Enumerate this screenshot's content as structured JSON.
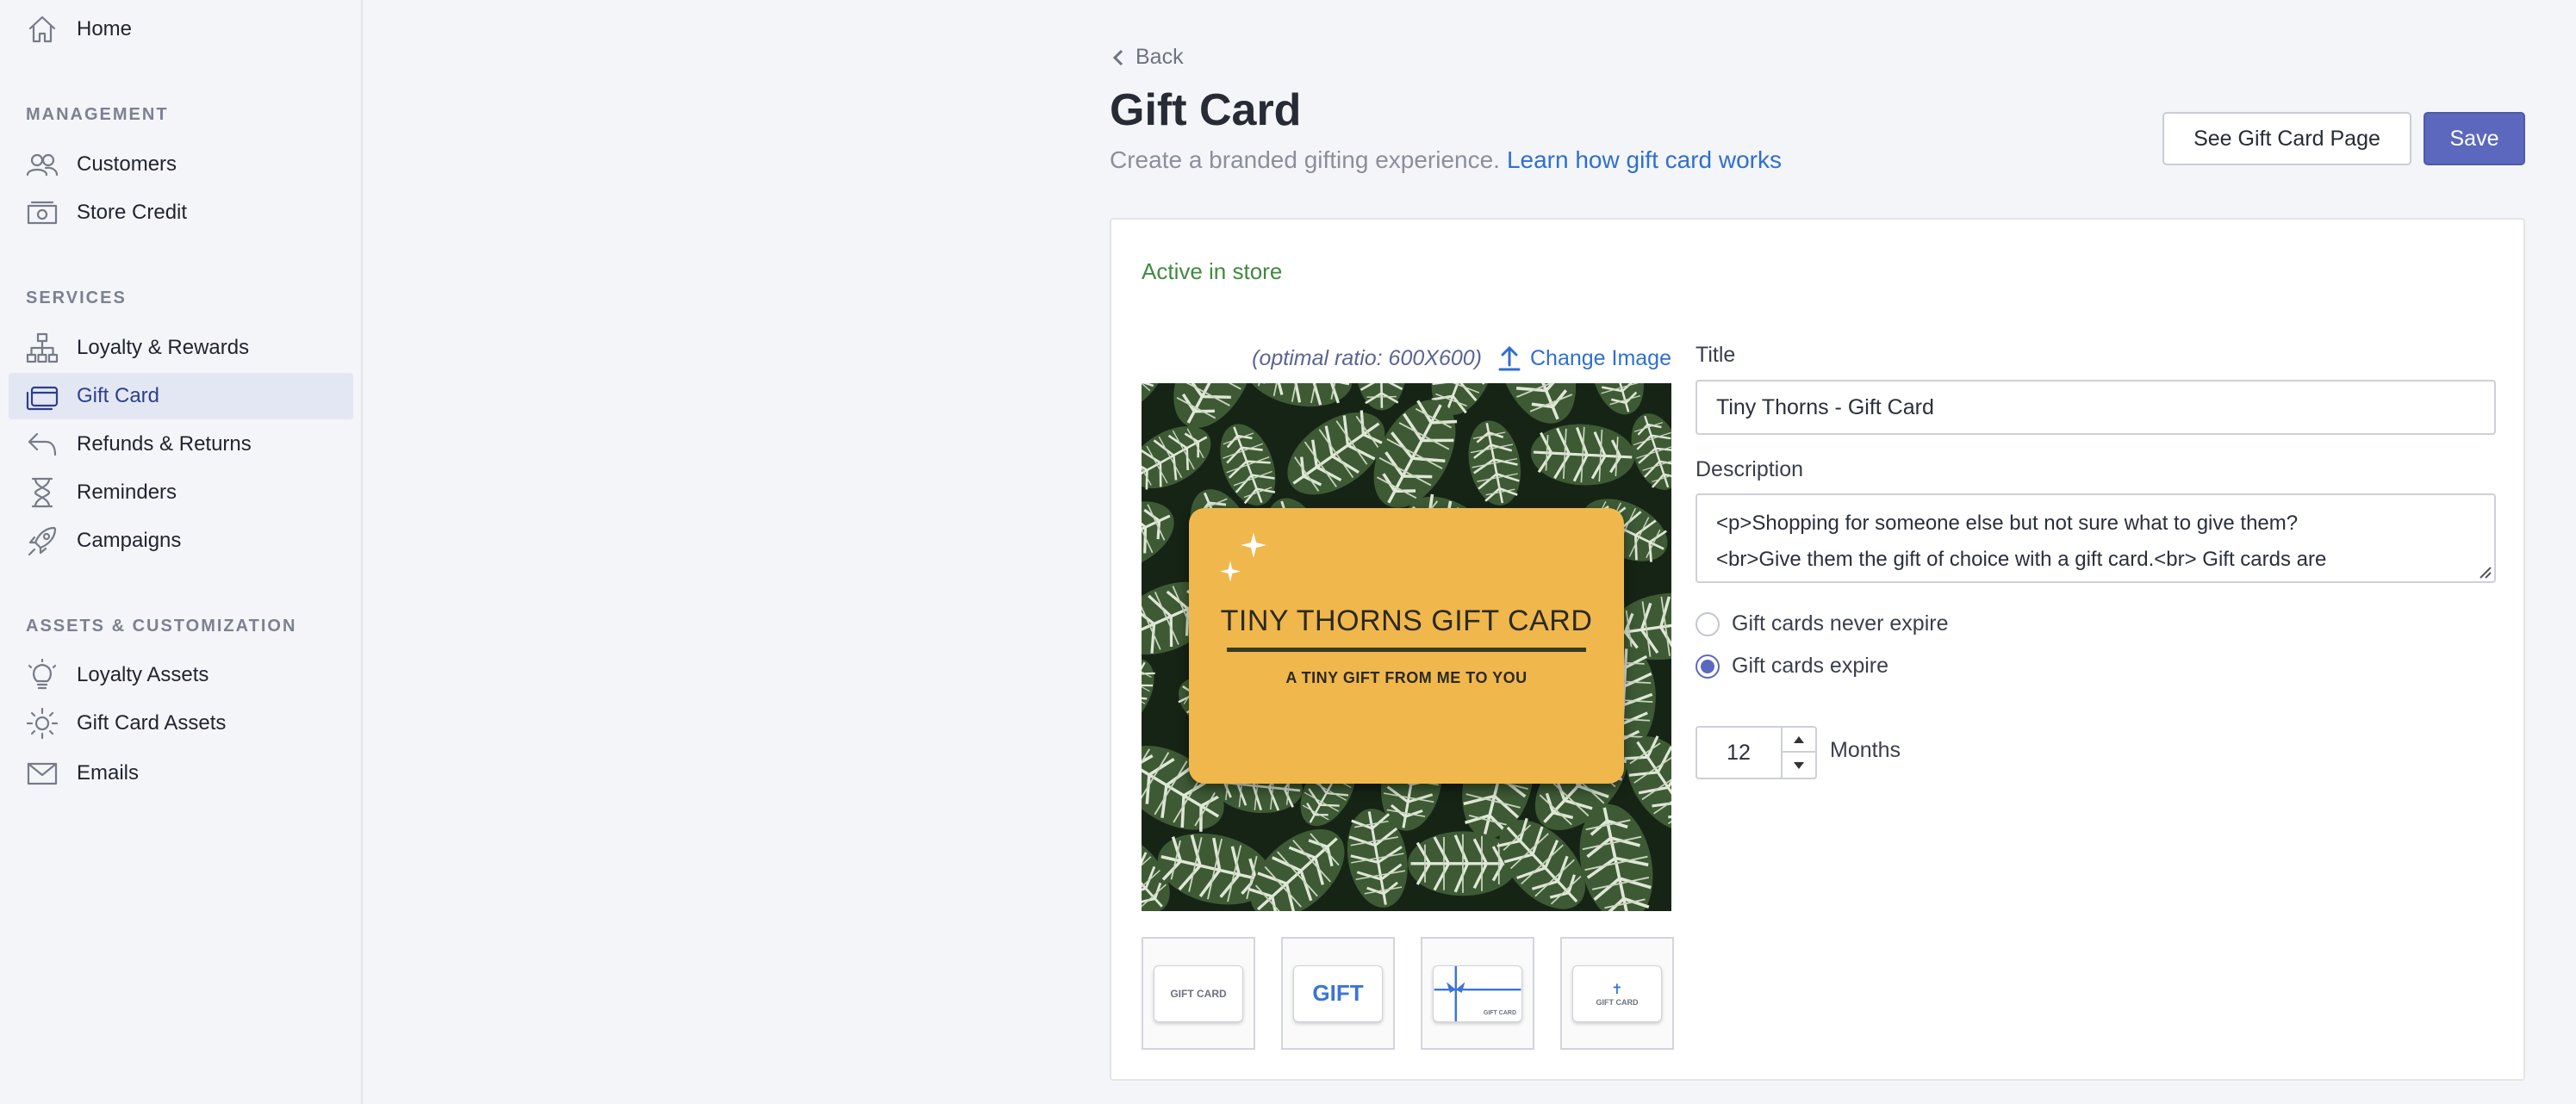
{
  "sidebar": {
    "home": "Home",
    "sections": {
      "management": "MANAGEMENT",
      "services": "SERVICES",
      "assets": "ASSETS & CUSTOMIZATION"
    },
    "items": [
      {
        "label": "Customers",
        "icon": "users-icon"
      },
      {
        "label": "Store Credit",
        "icon": "cash-icon"
      },
      {
        "label": "Loyalty & Rewards",
        "icon": "hierarchy-icon"
      },
      {
        "label": "Gift Card",
        "icon": "gift-card-icon",
        "active": true
      },
      {
        "label": "Refunds & Returns",
        "icon": "return-arrow-icon"
      },
      {
        "label": "Reminders",
        "icon": "hourglass-icon"
      },
      {
        "label": "Campaigns",
        "icon": "rocket-icon"
      },
      {
        "label": "Loyalty Assets",
        "icon": "lightbulb-icon"
      },
      {
        "label": "Gift Card Assets",
        "icon": "sun-icon"
      },
      {
        "label": "Emails",
        "icon": "envelope-icon"
      }
    ]
  },
  "header": {
    "back": "Back",
    "title": "Gift Card",
    "subtitle": "Create a branded gifting experience.",
    "learn_link": "Learn how gift card works",
    "see_page_button": "See Gift Card Page",
    "save_button": "Save"
  },
  "card": {
    "status": "Active in store",
    "ratio_note": "(optimal ratio: 600X600)",
    "change_image": "Change Image",
    "preview": {
      "title": "TINY THORNS GIFT CARD",
      "subtitle": "A TINY GIFT FROM ME TO YOU"
    },
    "thumbnails": [
      {
        "text": "GIFT CARD"
      },
      {
        "text": "GIFT"
      },
      {
        "text": "GIFT CARD"
      },
      {
        "text": "GIFT CARD"
      }
    ]
  },
  "form": {
    "title_label": "Title",
    "title_value": "Tiny Thorns - Gift Card",
    "description_label": "Description",
    "description_line1": "<p>Shopping for someone else but not sure what to give them?",
    "description_line2": "<br>Give them the gift of choice with a gift card.<br> Gift cards are",
    "expiry_options": [
      {
        "label": "Gift cards never expire",
        "checked": false
      },
      {
        "label": "Gift cards expire",
        "checked": true
      }
    ],
    "expiry_value": "12",
    "expiry_unit": "Months"
  },
  "colors": {
    "accent": "#5c68bd",
    "link": "#2f6fcf",
    "status_green": "#3f8a3f",
    "card_yellow": "#f0b74c"
  }
}
